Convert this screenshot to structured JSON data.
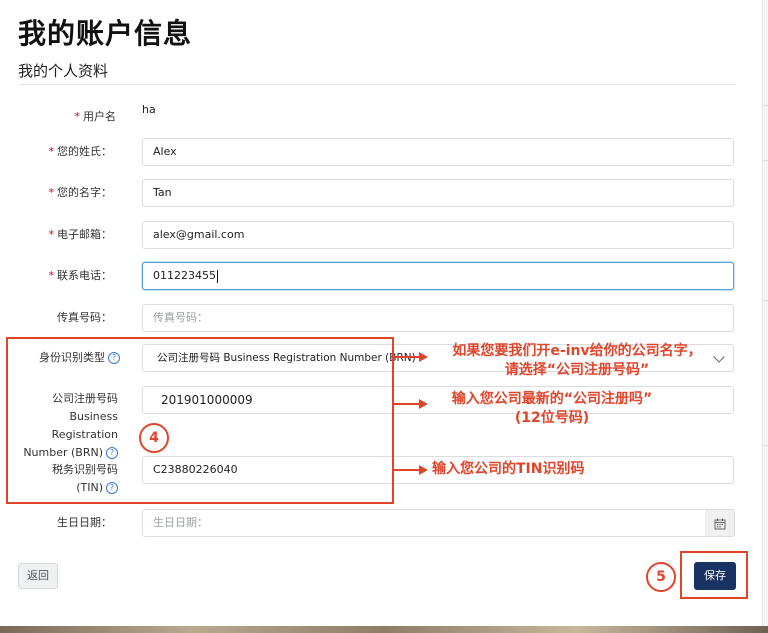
{
  "page": {
    "title": "我的账户信息",
    "section_title": "我的个人资料"
  },
  "fields": {
    "username": {
      "label": "用户名",
      "value": "ha"
    },
    "last_name": {
      "label": "您的姓氏：",
      "value": "Alex"
    },
    "first_name": {
      "label": "您的名字：",
      "value": "Tan"
    },
    "email": {
      "label": "电子邮箱：",
      "value": "alex@gmail.com"
    },
    "phone": {
      "label": "联系电话：",
      "value": "011223455"
    },
    "fax": {
      "label": "传真号码：",
      "placeholder": "传真号码："
    },
    "id_type": {
      "label": "身份识别类型",
      "selected": "公司注册号码 Business Registration Number (BRN)"
    },
    "brn": {
      "label_line1": "公司注册号码",
      "label_line2": "Business Registration",
      "label_line3": "Number (BRN)",
      "value": "201901000009"
    },
    "tin": {
      "label_line1": "税务识别号码",
      "label_line2": "(TIN)",
      "value": "C23880226040"
    },
    "birthday": {
      "label": "生日日期：",
      "placeholder": "生日日期："
    }
  },
  "buttons": {
    "back": "返回",
    "save": "保存"
  },
  "annotations": {
    "id_type_note_line1": "如果您要我们开e-inv给你的公司名字，",
    "id_type_note_line2": "请选择“公司注册号码”",
    "brn_note_line1": "输入您公司最新的“公司注册吗”",
    "brn_note_line2": "(12位号码)",
    "tin_note": "输入您公司的TIN识别码",
    "step4": "4",
    "step5": "5"
  },
  "icons": {
    "help": "question-circle-icon",
    "calendar": "calendar-icon",
    "dropdown": "chevron-down-icon"
  },
  "colors": {
    "accent_red": "#e0452b",
    "save_button": "#1a3163",
    "required": "#d0021b",
    "help_blue": "#3a7bd5"
  }
}
